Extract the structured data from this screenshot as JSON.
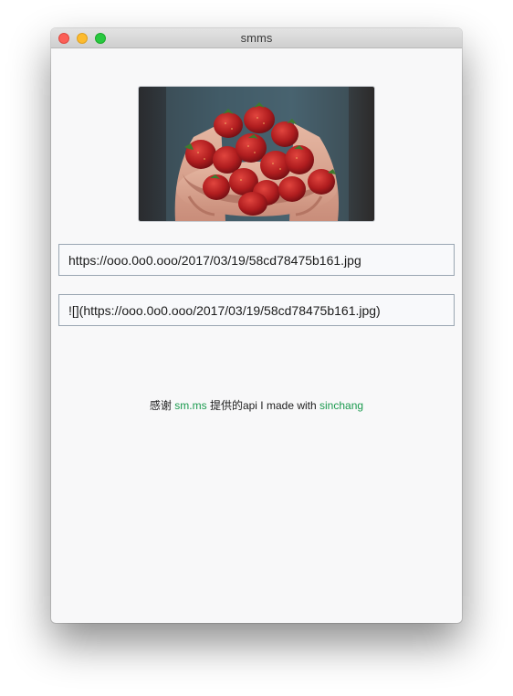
{
  "window": {
    "title": "smms"
  },
  "preview": {
    "image_subject": "strawberries-in-hands-photo"
  },
  "fields": {
    "url_value": "https://ooo.0o0.ooo/2017/03/19/58cd78475b161.jpg",
    "markdown_value": "![](https://ooo.0o0.ooo/2017/03/19/58cd78475b161.jpg)"
  },
  "credit": {
    "thanks_prefix": "感谢",
    "provider_link": "sm.ms",
    "middle_text": "提供的api I made with",
    "author_link": "sinchang"
  },
  "colors": {
    "link": "#1a9a4e",
    "close": "#fc5f57",
    "minimize": "#fdbb2e",
    "maximize": "#29c840"
  }
}
